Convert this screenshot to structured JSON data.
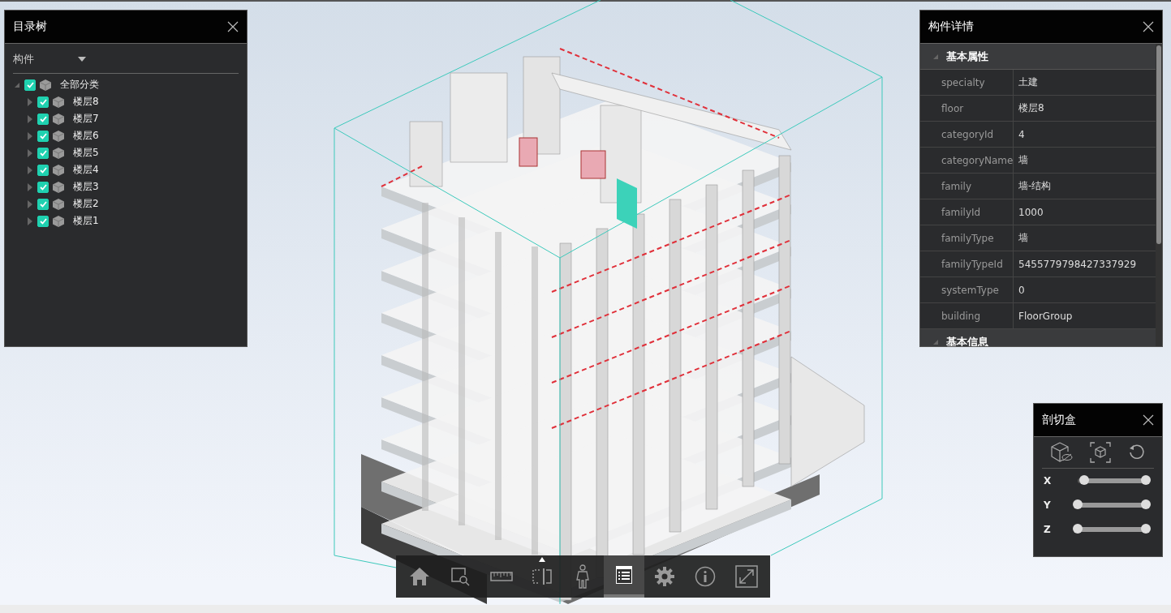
{
  "tree_panel": {
    "title": "目录树",
    "dropdown": {
      "value": "构件"
    },
    "tree": [
      {
        "label": "全部分类",
        "expanded": true,
        "checked": true,
        "children": [
          {
            "label": "楼层8",
            "expanded": false,
            "checked": true
          },
          {
            "label": "楼层7",
            "expanded": false,
            "checked": true
          },
          {
            "label": "楼层6",
            "expanded": false,
            "checked": true
          },
          {
            "label": "楼层5",
            "expanded": false,
            "checked": true
          },
          {
            "label": "楼层4",
            "expanded": false,
            "checked": true
          },
          {
            "label": "楼层3",
            "expanded": false,
            "checked": true
          },
          {
            "label": "楼层2",
            "expanded": false,
            "checked": true
          },
          {
            "label": "楼层1",
            "expanded": false,
            "checked": true
          }
        ]
      }
    ]
  },
  "detail_panel": {
    "title": "构件详情",
    "sections": [
      {
        "title": "基本属性",
        "expanded": true,
        "rows": [
          {
            "name": "specialty",
            "value": "土建"
          },
          {
            "name": "floor",
            "value": "楼层8"
          },
          {
            "name": "categoryId",
            "value": "4"
          },
          {
            "name": "categoryName",
            "value": "墙"
          },
          {
            "name": "family",
            "value": "墙-结构"
          },
          {
            "name": "familyId",
            "value": "1000"
          },
          {
            "name": "familyType",
            "value": "墙"
          },
          {
            "name": "familyTypeId",
            "value": "5455779798427337929"
          },
          {
            "name": "systemType",
            "value": "0"
          },
          {
            "name": "building",
            "value": "FloorGroup"
          }
        ]
      },
      {
        "title": "基本信息",
        "expanded": true
      }
    ]
  },
  "section_box_panel": {
    "title": "剖切盒",
    "tools": [
      {
        "kind": "hide"
      },
      {
        "kind": "fit"
      },
      {
        "kind": "reset"
      }
    ],
    "sliders": [
      {
        "axis": "X",
        "handles": [
          {
            "level": 0.1
          },
          {
            "level": 1
          }
        ]
      },
      {
        "axis": "Y",
        "handles": [
          {
            "level": 0
          },
          {
            "level": 1
          }
        ]
      },
      {
        "axis": "Z",
        "handles": [
          {
            "level": 0
          },
          {
            "level": 1
          }
        ]
      }
    ]
  },
  "toolbar": [
    {
      "kind": "home",
      "selected": false,
      "expanded": false
    },
    {
      "kind": "zoom-area",
      "selected": false,
      "expanded": false
    },
    {
      "kind": "measure",
      "selected": false,
      "expanded": false
    },
    {
      "kind": "section",
      "selected": false,
      "expanded": true
    },
    {
      "kind": "person",
      "selected": false,
      "expanded": false
    },
    {
      "kind": "properties",
      "selected": true,
      "expanded": false
    },
    {
      "kind": "settings",
      "selected": false,
      "expanded": false
    },
    {
      "kind": "info",
      "selected": false,
      "expanded": false
    },
    {
      "kind": "fullscreen",
      "selected": false,
      "expanded": false
    }
  ]
}
